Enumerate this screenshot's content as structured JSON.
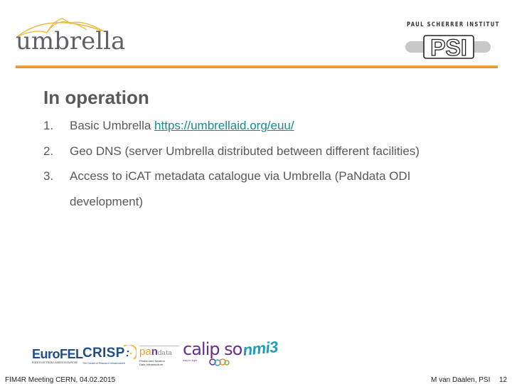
{
  "header": {
    "left_logo": {
      "name": "umbrella",
      "text": "umbrella",
      "color": "#5f6066",
      "accent": "#f0b840"
    },
    "right_logo": {
      "institute": "PAUL SCHERRER INSTITUT",
      "mark": "PSI"
    },
    "rule_color": "#e8892b"
  },
  "slide": {
    "title": "In operation",
    "items": [
      {
        "num": "1.",
        "text": "Basic Umbrella ",
        "link": "https://umbrellaid.org/euu/"
      },
      {
        "num": "2.",
        "text": "Geo DNS (server Umbrella distributed between different facilities)"
      },
      {
        "num": "3.",
        "text": "Access to iCAT metadata catalogue via Umbrella (PaNdata ODI",
        "continuation": "development)"
      }
    ],
    "link_color": "#1a8a8a"
  },
  "partner_logos": [
    {
      "name": "EuroFEL",
      "text": "EuroFEL",
      "subtext": "FREE ELECTRON LASERS IN EUROPE"
    },
    {
      "name": "CRISP",
      "text": "CRISP",
      "subtext": "The Cluster of Research Infrastructures for Synergies in Physics"
    },
    {
      "name": "PaNdata",
      "text_pa": "pa",
      "text_n": "n",
      "text_data": "data",
      "subtext1": "Photon and Neutron",
      "subtext2": "Data Infrastructure"
    },
    {
      "name": "CALIPSO",
      "text": "calip so",
      "subtext": "way to light"
    },
    {
      "name": "NMI3",
      "text": "nmi3"
    }
  ],
  "footer": {
    "left": "FIM4R Meeting CERN, 04.02.2015",
    "right": "M van Daalen, PSI",
    "page": "12"
  }
}
